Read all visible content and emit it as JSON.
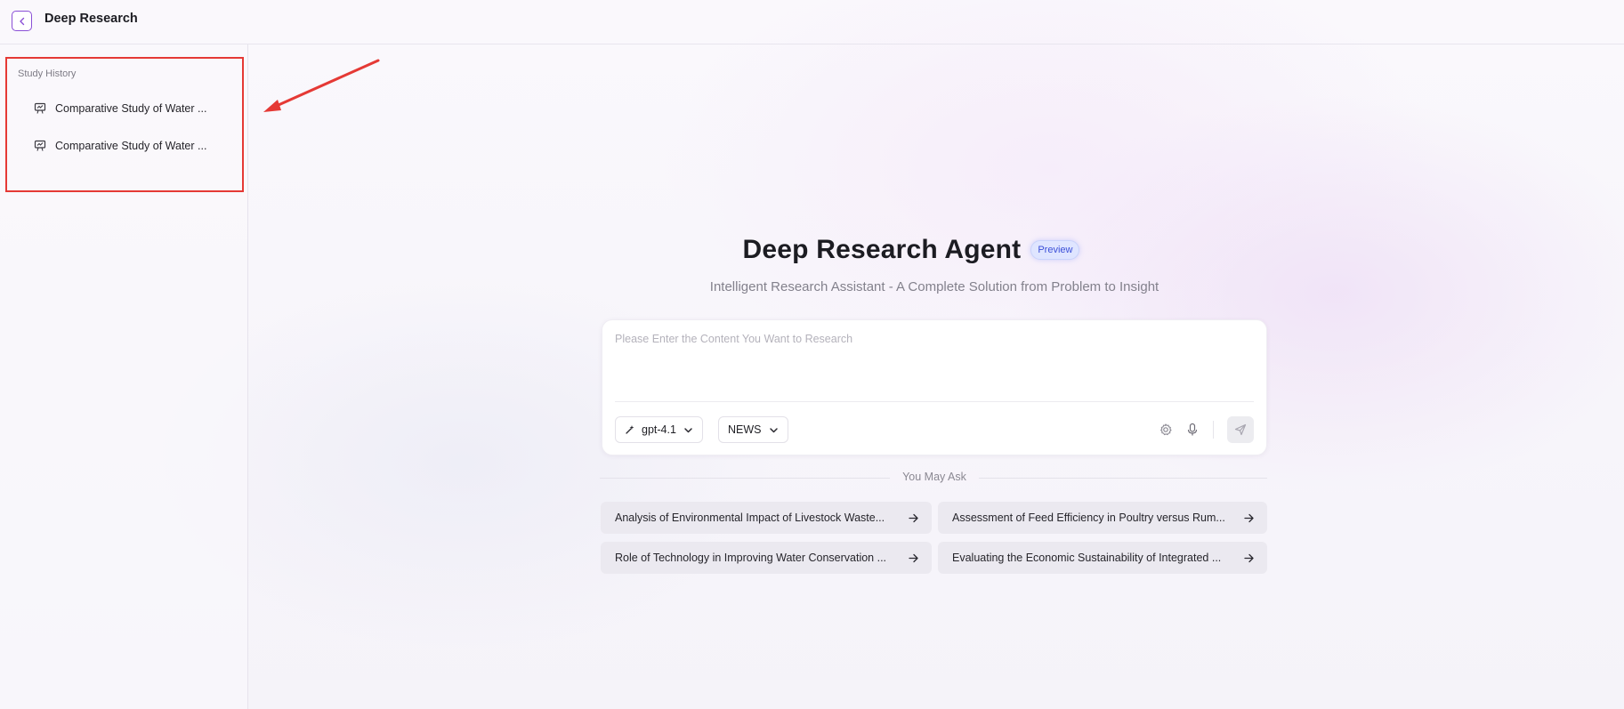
{
  "topbar": {
    "title": "Deep Research"
  },
  "sidebar": {
    "heading": "Study History",
    "items": [
      {
        "label": "Comparative Study of Water ..."
      },
      {
        "label": "Comparative Study of Water ..."
      }
    ]
  },
  "hero": {
    "title": "Deep Research Agent",
    "badge": "Preview",
    "subtitle": "Intelligent Research Assistant - A Complete Solution from Problem to Insight"
  },
  "input": {
    "placeholder": "Please Enter the Content You Want to Research",
    "value": "",
    "model_label": "gpt-4.1",
    "source_label": "NEWS"
  },
  "ask": {
    "label": "You May Ask",
    "suggestions": [
      "Analysis of Environmental Impact of Livestock Waste...",
      "Assessment of Feed Efficiency in Poultry versus Rum...",
      "Role of Technology in Improving Water Conservation ...",
      "Evaluating the Economic Sustainability of Integrated ..."
    ]
  },
  "colors": {
    "accent": "#8a4fd6",
    "annotation": "#e53935",
    "badge_bg": "#dfe5ff",
    "badge_text": "#3b4fd8"
  },
  "icons": [
    "back-arrow-icon",
    "presentation-icon",
    "sparkle-icon",
    "chevron-down-icon",
    "settings-icon",
    "microphone-icon",
    "send-icon",
    "arrow-right-icon"
  ]
}
